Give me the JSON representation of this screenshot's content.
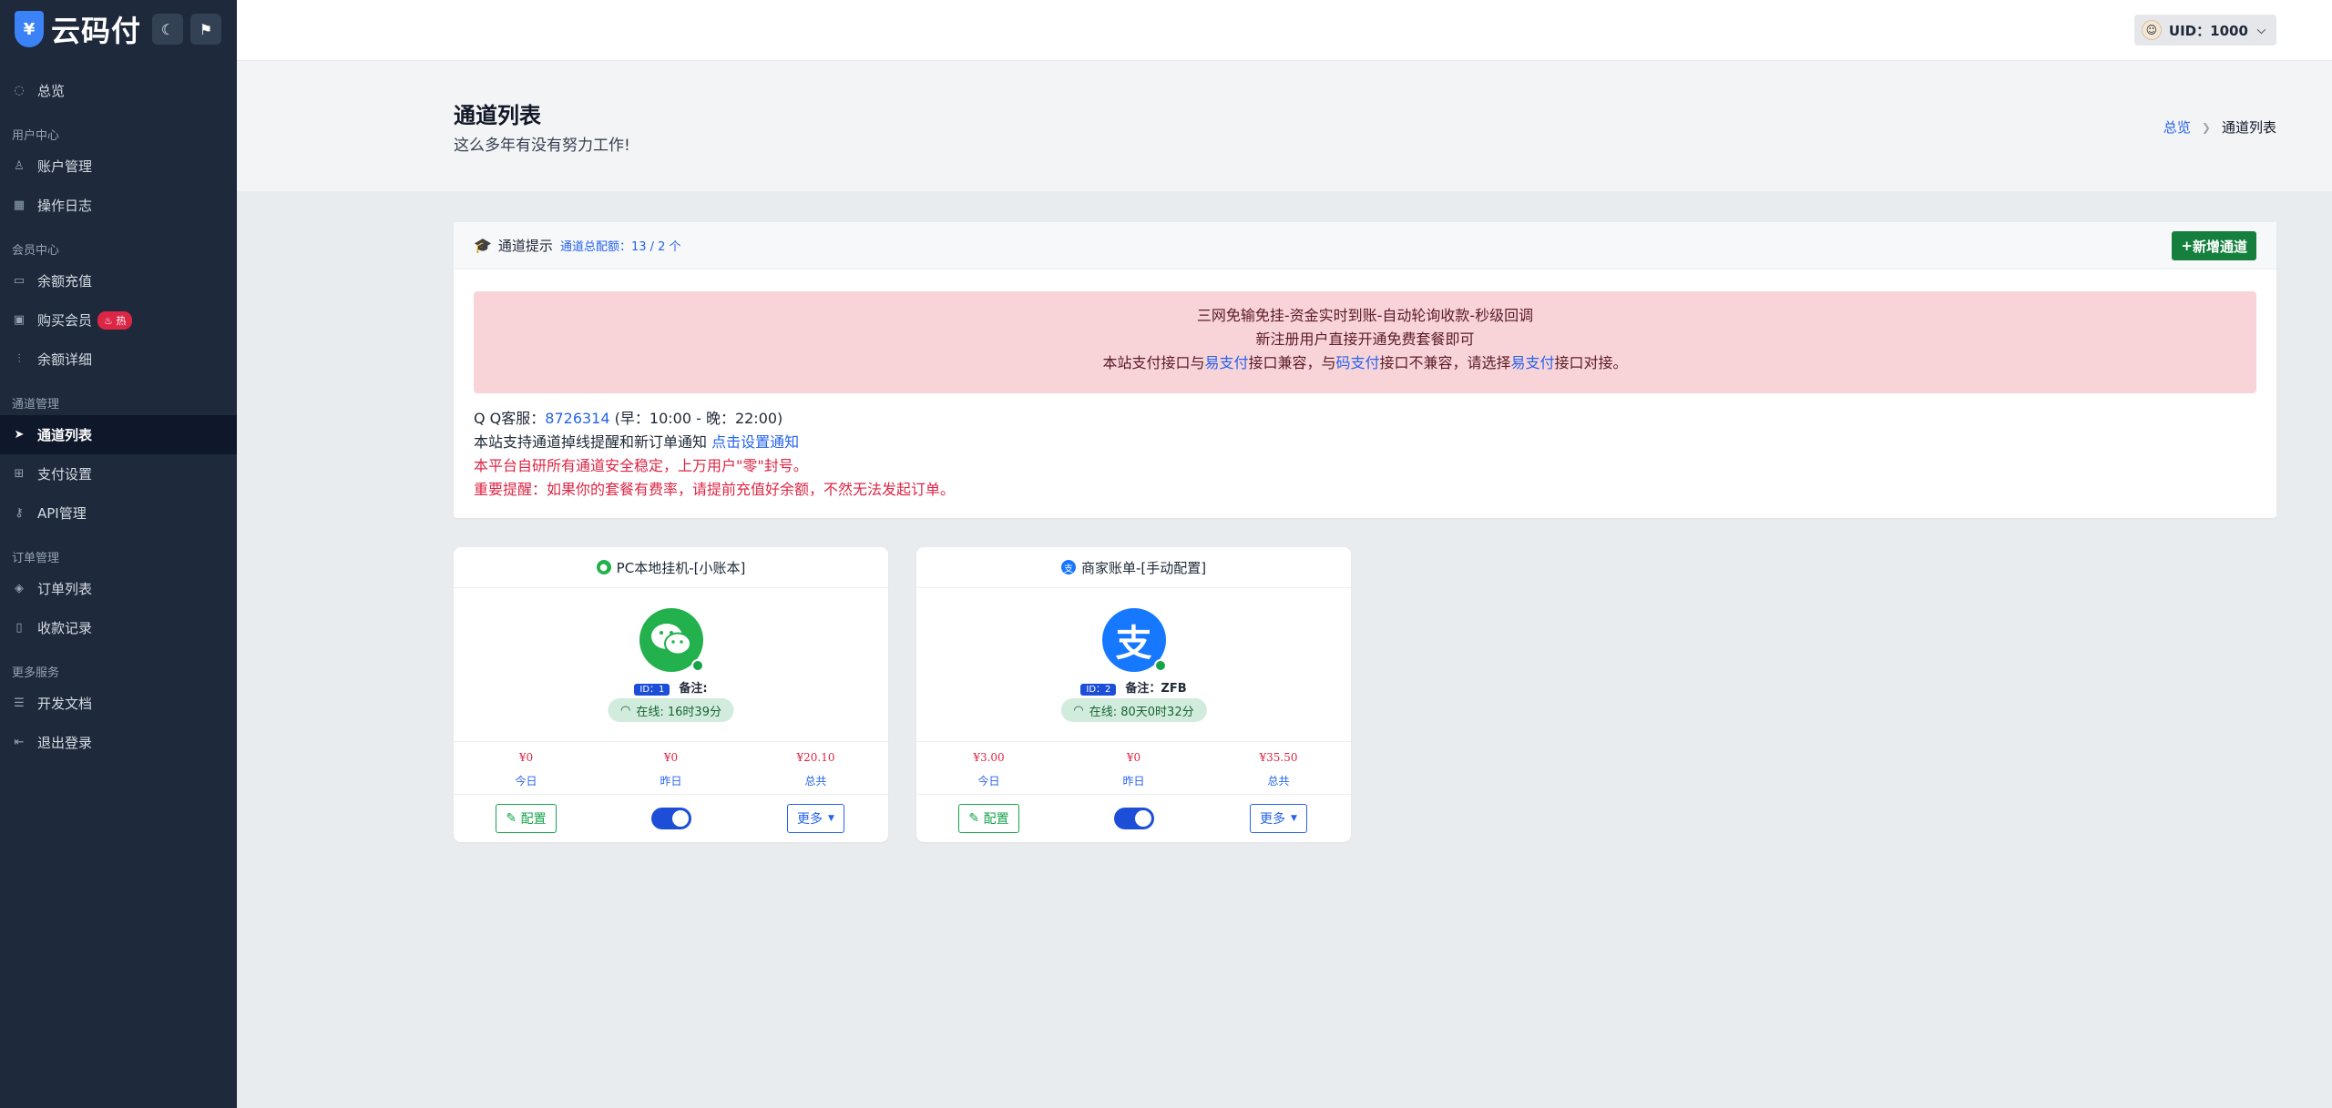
{
  "brand": {
    "logo_glyph": "¥",
    "name": "云码付",
    "moon_icon": "☾",
    "pin_icon": "⚑"
  },
  "sidebar": {
    "overview": "总览",
    "sections": [
      {
        "title": "用户中心",
        "items": [
          "账户管理",
          "操作日志"
        ]
      },
      {
        "title": "会员中心",
        "items": [
          "余额充值",
          "购买会员",
          "余额详细"
        ],
        "hot_badge": "热"
      },
      {
        "title": "通道管理",
        "items": [
          "通道列表",
          "支付设置",
          "API管理"
        ]
      },
      {
        "title": "订单管理",
        "items": [
          "订单列表",
          "收款记录"
        ]
      },
      {
        "title": "更多服务",
        "items": [
          "开发文档",
          "退出登录"
        ]
      }
    ]
  },
  "topbar": {
    "user": "UID：1000"
  },
  "header": {
    "title": "通道列表",
    "subtitle": "这么多年有没有努力工作!",
    "breadcrumb_home": "总览",
    "breadcrumb_current": "通道列表"
  },
  "notice": {
    "title": "通道提示",
    "quota": "通道总配额：13 / 2 个",
    "add_button": "新增通道",
    "alert_line1": "三网免输免挂-资金实时到账-自动轮询收款-秒级回调",
    "alert_line2": "新注册用户直接开通免费套餐即可",
    "alert_line3_a": "本站支付接口与",
    "alert_line3_b": "易支付",
    "alert_line3_c": "接口兼容，与",
    "alert_line3_d": "码支付",
    "alert_line3_e": "接口不兼容，请选择",
    "alert_line3_f": "易支付",
    "alert_line3_g": "接口对接。",
    "qq_label": "Q Q客服：",
    "qq_number": "8726314",
    "qq_hours": "(早：10:00 - 晚：22:00)",
    "notify_text": "本站支持通道掉线提醒和新订单通知",
    "notify_link": "点击设置通知",
    "red_line1": "本平台自研所有通道安全稳定，上万用户\"零\"封号。",
    "red_line2": "重要提醒：如果你的套餐有费率，请提前充值好余额，不然无法发起订单。"
  },
  "channels": [
    {
      "title": "PC本地挂机-[小账本]",
      "id_badge": "ID：1",
      "remark": "备注:",
      "online": "在线: 16时39分",
      "today": "¥0",
      "yesterday": "¥0",
      "total": "¥20.10",
      "today_label": "今日",
      "yesterday_label": "昨日",
      "total_label": "总共",
      "config_label": "配置",
      "more_label": "更多",
      "logo_color": "#22b14c",
      "enabled": true
    },
    {
      "title": "商家账单-[手动配置]",
      "id_badge": "ID：2",
      "remark": "备注：ZFB",
      "online": "在线: 80天0时32分",
      "today": "¥3.00",
      "yesterday": "¥0",
      "total": "¥35.50",
      "today_label": "今日",
      "yesterday_label": "昨日",
      "total_label": "总共",
      "config_label": "配置",
      "more_label": "更多",
      "logo_color": "#1677ff",
      "logo_glyph": "支",
      "enabled": true
    }
  ]
}
